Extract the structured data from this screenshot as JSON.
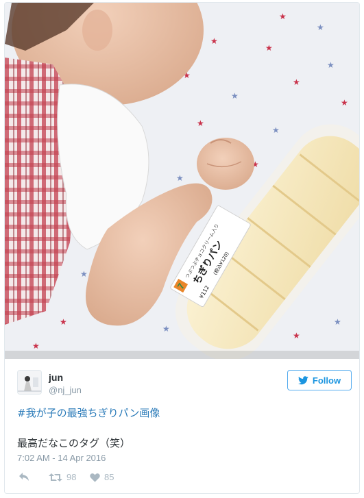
{
  "tweet": {
    "author_name": "jun",
    "author_handle": "@nj_jun",
    "follow_label": "Follow",
    "hashtag": "#我が子の最強ちぎりパン画像",
    "text": "最高だなこのタグ（笑）",
    "timestamp": "7:02 AM - 14 Apr 2016",
    "retweet_count": "98",
    "like_count": "85"
  },
  "photo": {
    "label_brand": "7",
    "label_title": "ちぎりパン",
    "label_subtitle": "つぶつぶチョコクリーム入り",
    "label_price": "¥112",
    "label_tax_price": "(税込¥120)"
  },
  "colors": {
    "link": "#2b7bb9",
    "follow_border": "#55acee",
    "muted": "#8899a6",
    "text": "#292f33"
  },
  "icons": {
    "follow": "twitter-bird-icon",
    "reply": "reply-icon",
    "retweet": "retweet-icon",
    "like": "heart-icon"
  }
}
